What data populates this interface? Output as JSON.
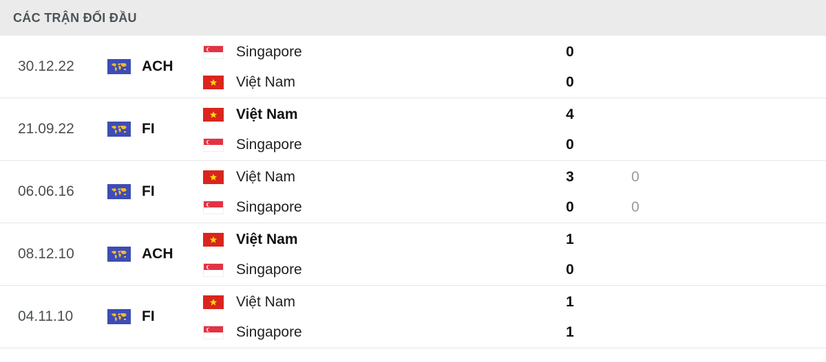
{
  "header": {
    "title": "CÁC TRẬN ĐỐI ĐẦU"
  },
  "icons": {
    "competition": "world-map-icon",
    "vietnam_flag": "vietnam-flag-icon",
    "singapore_flag": "singapore-flag-icon"
  },
  "colors": {
    "header_bg": "#ebebeb",
    "competition_icon_bg": "#3d4db5",
    "vn_red": "#da251d",
    "sg_red": "#e33343"
  },
  "matches": [
    {
      "date": "30.12.22",
      "competition": "ACH",
      "home": {
        "name": "Singapore",
        "flag": "sg",
        "score": "0",
        "winner": false,
        "secondary": ""
      },
      "away": {
        "name": "Việt Nam",
        "flag": "vn",
        "score": "0",
        "winner": false,
        "secondary": ""
      }
    },
    {
      "date": "21.09.22",
      "competition": "FI",
      "home": {
        "name": "Việt Nam",
        "flag": "vn",
        "score": "4",
        "winner": true,
        "secondary": ""
      },
      "away": {
        "name": "Singapore",
        "flag": "sg",
        "score": "0",
        "winner": false,
        "secondary": ""
      }
    },
    {
      "date": "06.06.16",
      "competition": "FI",
      "home": {
        "name": "Việt Nam",
        "flag": "vn",
        "score": "3",
        "winner": false,
        "secondary": "0"
      },
      "away": {
        "name": "Singapore",
        "flag": "sg",
        "score": "0",
        "winner": false,
        "secondary": "0"
      }
    },
    {
      "date": "08.12.10",
      "competition": "ACH",
      "home": {
        "name": "Việt Nam",
        "flag": "vn",
        "score": "1",
        "winner": true,
        "secondary": ""
      },
      "away": {
        "name": "Singapore",
        "flag": "sg",
        "score": "0",
        "winner": false,
        "secondary": ""
      }
    },
    {
      "date": "04.11.10",
      "competition": "FI",
      "home": {
        "name": "Việt Nam",
        "flag": "vn",
        "score": "1",
        "winner": false,
        "secondary": ""
      },
      "away": {
        "name": "Singapore",
        "flag": "sg",
        "score": "1",
        "winner": false,
        "secondary": ""
      }
    }
  ]
}
